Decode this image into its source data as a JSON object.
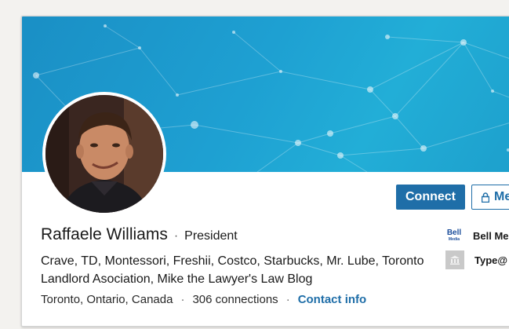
{
  "profile": {
    "name": "Raffaele Williams",
    "separator": "·",
    "title": "President",
    "headline": "Crave, TD, Montessori, Freshii, Costco, Starbucks, Mr. Lube, Toronto Landlord Asociation, Mike the Lawyer's Law Blog",
    "location": "Toronto, Ontario, Canada",
    "connections": "306 connections",
    "contact_info": "Contact info"
  },
  "actions": {
    "connect_label": "Connect",
    "more_label": "Me"
  },
  "experience": [
    {
      "logo_text": "Bell",
      "logo_subtext": "Media",
      "label": "Bell Me"
    },
    {
      "label": "Type@"
    }
  ],
  "colors": {
    "accent": "#1f6ea8",
    "banner": "#1ea0d2"
  }
}
